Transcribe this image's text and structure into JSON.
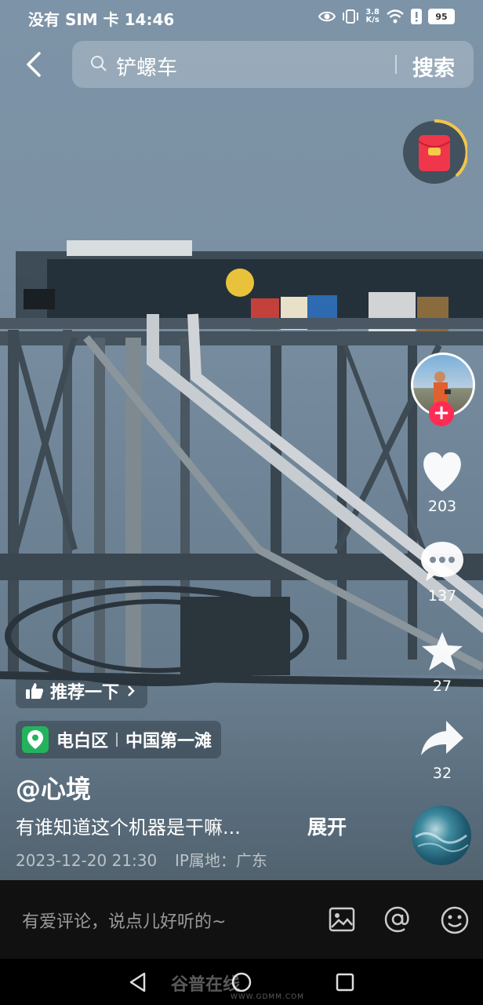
{
  "status_bar": {
    "carrier_time": "没有 SIM 卡 14:46",
    "net_speed_value": "3.8",
    "net_speed_unit": "K/s",
    "battery": "95",
    "icons": [
      "eye-icon",
      "vibrate-icon",
      "wifi-icon",
      "alert-icon",
      "battery-icon"
    ]
  },
  "search": {
    "query": "铲螺车",
    "button": "搜索"
  },
  "video": {
    "recommend_label": "推荐一下",
    "location_area": "电白区",
    "location_place": "中国第一滩",
    "author": "@心境",
    "description": "有谁知道这个机器是干嘛...",
    "expand_label": "展开",
    "date": "2023-12-20 21:30",
    "ip_location": "IP属地：广东"
  },
  "actions": {
    "likes": "203",
    "comments": "137",
    "favorites": "27",
    "shares": "32"
  },
  "comment_bar": {
    "placeholder": "有爱评论，说点儿好听的~"
  },
  "watermark": {
    "brand": "谷普在线",
    "url": "WWW.GDMM.COM"
  },
  "colors": {
    "accent": "#fe2c55",
    "location_green": "#24b35d",
    "red_packet": "#f0364a"
  }
}
